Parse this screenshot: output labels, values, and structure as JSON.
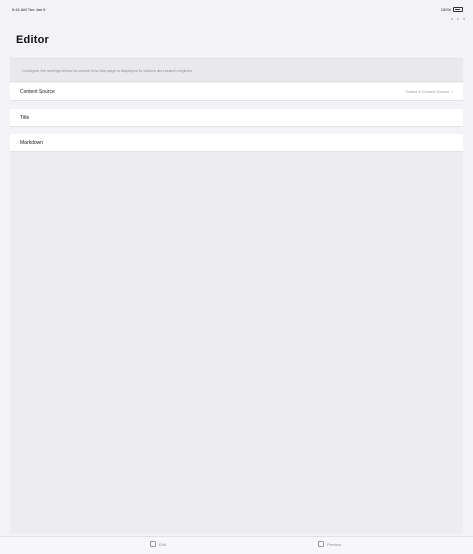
{
  "status_bar": {
    "left": "9:41 AM  Tue Jan 9",
    "right": "100%"
  },
  "title": "Editor",
  "description": "Configure the settings below to control how this page is displayed to visitors and search engines.",
  "rows": [
    {
      "label": "Content Source",
      "value": "Select a Content Source"
    },
    {
      "label": "Title",
      "value": ""
    },
    {
      "label": "Markdown",
      "value": ""
    }
  ],
  "tabs": [
    {
      "label": "Edit",
      "icon": "edit-icon"
    },
    {
      "label": "Preview",
      "icon": "preview-icon"
    }
  ]
}
